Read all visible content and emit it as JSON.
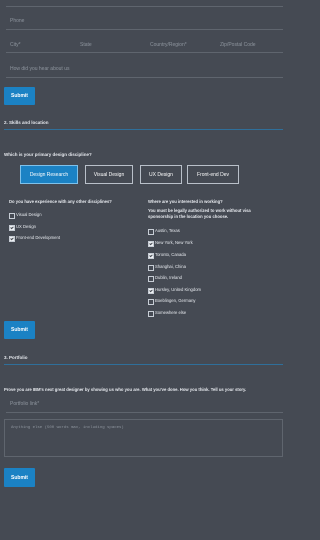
{
  "contact": {
    "phone_placeholder": "Phone",
    "city_placeholder": "City*",
    "state_placeholder": "State",
    "country_placeholder": "Country/Region*",
    "zip_placeholder": "Zip/Postal Code",
    "source_placeholder": "How did you hear about us",
    "submit_label": "Submit"
  },
  "skills": {
    "section_title": "2. Skills and location",
    "question": "Which is your primary design discipline?",
    "disciplines": [
      {
        "label": "Design Research",
        "active": true
      },
      {
        "label": "Visual Design",
        "active": false
      },
      {
        "label": "UX Design",
        "active": false
      },
      {
        "label": "Front-end Dev",
        "active": false
      }
    ],
    "experience_question": "Do you have experience with any other disciplines?",
    "experience_options": [
      {
        "label": "Visual Design",
        "checked": false
      },
      {
        "label": "UX Design",
        "checked": true
      },
      {
        "label": "Front-end Development",
        "checked": true
      }
    ],
    "location_question": "Where are you interested in working?",
    "location_note_1": "You must be legally authorized to work without visa",
    "location_note_2": "sponsorship in the location you choose.",
    "locations": [
      {
        "label": "Austin, Texas",
        "checked": false
      },
      {
        "label": "New York, New York",
        "checked": true
      },
      {
        "label": "Toronto, Canada",
        "checked": true
      },
      {
        "label": "Shanghai, China",
        "checked": false
      },
      {
        "label": "Dublin, Ireland",
        "checked": false
      },
      {
        "label": "Hursley, United Kingdom",
        "checked": true
      },
      {
        "label": "Boeblingen, Germany",
        "checked": false
      },
      {
        "label": "Somewhere else",
        "checked": false
      }
    ],
    "submit_label": "Submit"
  },
  "portfolio": {
    "section_title": "3. Portfolio",
    "prompt": "Prove you are IBM's next great designer by showing us who you are. What you've done. How you think. Tell us your story.",
    "link_placeholder": "Portfolio link*",
    "textarea_placeholder": "Anything else (500 words max, including spaces)",
    "submit_label": "Submit"
  }
}
